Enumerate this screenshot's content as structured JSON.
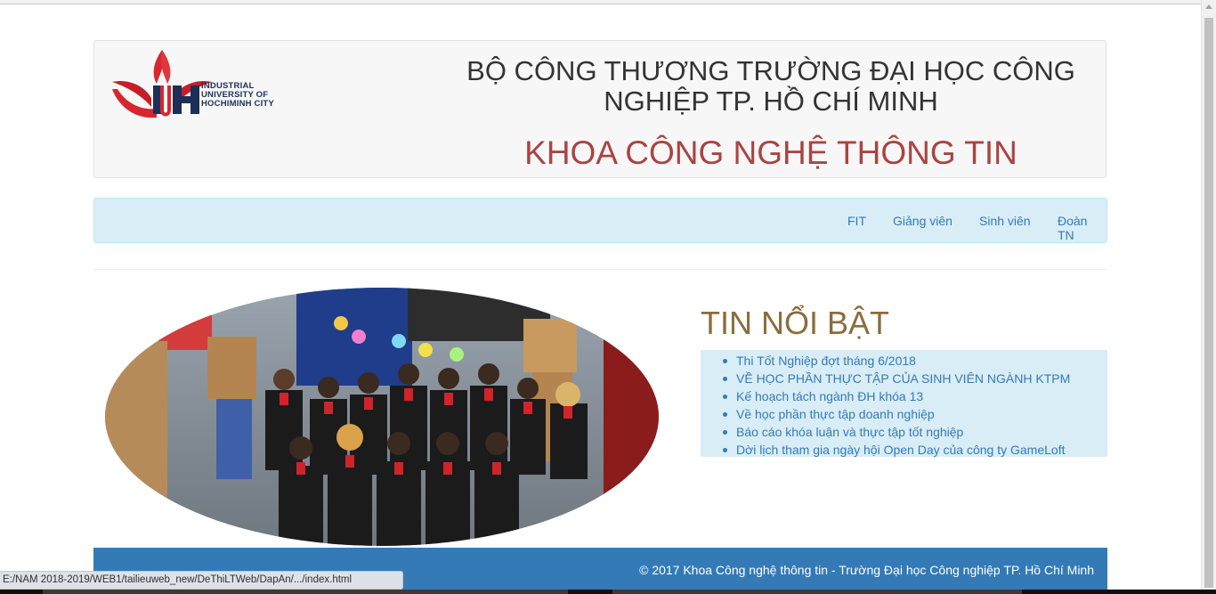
{
  "header": {
    "logo_alt": "INDUSTRIAL UNIVERSITY OF HOCHIMINH CITY",
    "logo_line1": "INDUSTRIAL",
    "logo_line2": "UNIVERSITY OF",
    "logo_line3": "HOCHIMINH CITY",
    "logo_mark": "IUH",
    "uni_title": "BỘ CÔNG THƯƠNG TRƯỜNG ĐẠI HỌC CÔNG NGHIỆP TP. HỒ CHÍ MINH",
    "faculty_title": "KHOA CÔNG NGHỆ THÔNG TIN"
  },
  "nav": {
    "items": [
      {
        "label": "FIT"
      },
      {
        "label": "Giảng viên"
      },
      {
        "label": "Sinh viên"
      },
      {
        "label": "Đoàn TN"
      }
    ]
  },
  "news": {
    "title": "TIN NỔI BẬT",
    "items": [
      "Thi Tốt Nghiệp đợt tháng 6/2018",
      "VỀ HỌC PHẦN THỰC TẬP CỦA SINH VIÊN NGÀNH KTPM",
      "Kế hoạch tách ngành ĐH khóa 13",
      "Về học phần thực tập doanh nghiệp",
      "Báo cáo khóa luận và thực tập tốt nghiệp",
      "Dời lịch tham gia ngày hội Open Day của công ty GameLoft"
    ]
  },
  "footer": {
    "text": "© 2017 Khoa Công nghệ thông tin - Trường Đại học Công nghiệp TP. Hồ Chí Minh"
  },
  "status_url": "E:/NAM 2018-2019/WEB1/tailieuweb_new/DeThiLTWeb/DapAn/.../index.html",
  "colors": {
    "faculty_red": "#a94442",
    "news_title_brown": "#8a6d3b",
    "link_blue": "#337ab7",
    "info_bg": "#d9edf7",
    "footer_bg": "#337ab7"
  }
}
